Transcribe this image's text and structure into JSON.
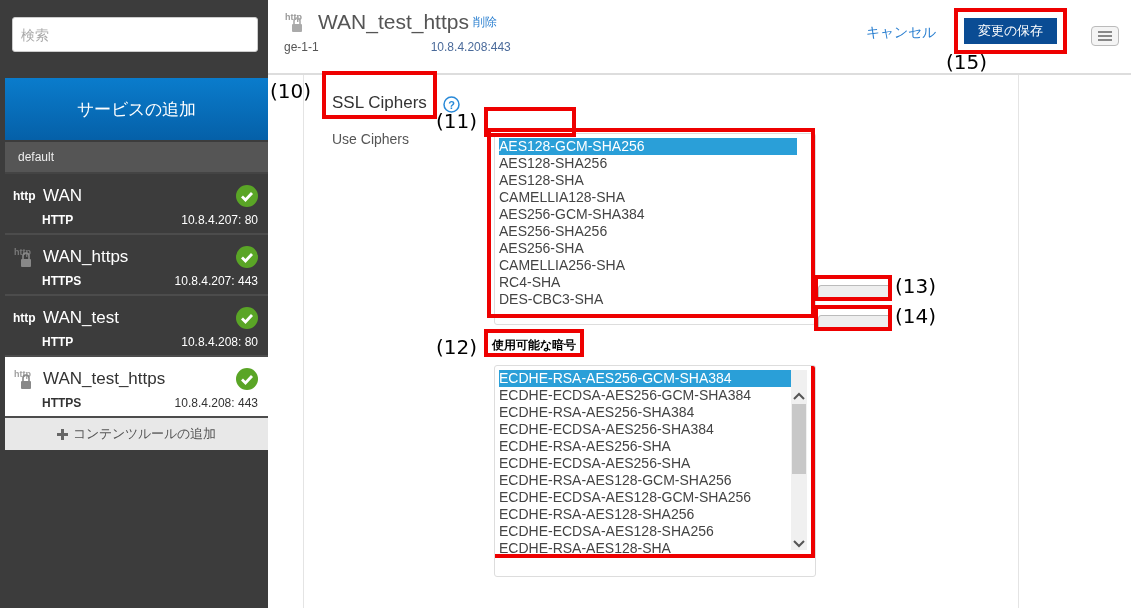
{
  "sidebar": {
    "search": {
      "placeholder": "検索"
    },
    "add_service_button": "サービスの追加",
    "group": "default",
    "services": [
      {
        "kind": "http",
        "protocol_label": "http",
        "name": "WAN",
        "type": "HTTP",
        "address": "10.8.4.207: 80",
        "ok": true,
        "selected": false
      },
      {
        "kind": "https",
        "protocol_label": "http",
        "name": "WAN_https",
        "type": "HTTPS",
        "address": "10.8.4.207: 443",
        "ok": true,
        "selected": false
      },
      {
        "kind": "http",
        "protocol_label": "http",
        "name": "WAN_test",
        "type": "HTTP",
        "address": "10.8.4.208: 80",
        "ok": true,
        "selected": false
      },
      {
        "kind": "https",
        "protocol_label": "http",
        "name": "WAN_test_https",
        "type": "HTTPS",
        "address": "10.8.4.208: 443",
        "ok": true,
        "selected": true
      }
    ],
    "add_rule_button": "コンテンツルールの追加"
  },
  "header": {
    "protocol_label": "http",
    "name": "WAN_test_https",
    "delete_link": "削除",
    "interface": "ge-1-1",
    "address": "10.8.4.208:443",
    "cancel": "キャンセル",
    "save": {
      "label": "変更の保存",
      "callout": "(15)"
    }
  },
  "section": {
    "title": "SSL Ciphers",
    "callout": "(10)",
    "help": "?",
    "field_label": "Use Ciphers",
    "selected_ciphers": {
      "label_callout": "(11)",
      "list_highlighted": true,
      "items": [
        {
          "name": "AES128-GCM-SHA256",
          "selected": true
        },
        {
          "name": "AES128-SHA256",
          "selected": false
        },
        {
          "name": "AES128-SHA",
          "selected": false
        },
        {
          "name": "CAMELLIA128-SHA",
          "selected": false
        },
        {
          "name": "AES256-GCM-SHA384",
          "selected": false
        },
        {
          "name": "AES256-SHA256",
          "selected": false
        },
        {
          "name": "AES256-SHA",
          "selected": false
        },
        {
          "name": "CAMELLIA256-SHA",
          "selected": false
        },
        {
          "name": "RC4-SHA",
          "selected": false
        },
        {
          "name": "DES-CBC3-SHA",
          "selected": false
        }
      ]
    },
    "add_button": {
      "callout": "(13)"
    },
    "remove_button": {
      "callout": "(14)"
    },
    "available_ciphers": {
      "label": "使用可能な暗号",
      "label_callout": "(12)",
      "list_highlighted": true,
      "items": [
        {
          "name": "ECDHE-RSA-AES256-GCM-SHA384",
          "selected": true
        },
        {
          "name": "ECDHE-ECDSA-AES256-GCM-SHA384",
          "selected": false
        },
        {
          "name": "ECDHE-RSA-AES256-SHA384",
          "selected": false
        },
        {
          "name": "ECDHE-ECDSA-AES256-SHA384",
          "selected": false
        },
        {
          "name": "ECDHE-RSA-AES256-SHA",
          "selected": false
        },
        {
          "name": "ECDHE-ECDSA-AES256-SHA",
          "selected": false
        },
        {
          "name": "ECDHE-RSA-AES128-GCM-SHA256",
          "selected": false
        },
        {
          "name": "ECDHE-ECDSA-AES128-GCM-SHA256",
          "selected": false
        },
        {
          "name": "ECDHE-RSA-AES128-SHA256",
          "selected": false
        },
        {
          "name": "ECDHE-ECDSA-AES128-SHA256",
          "selected": false
        },
        {
          "name": "ECDHE-RSA-AES128-SHA",
          "selected": false
        }
      ]
    }
  }
}
